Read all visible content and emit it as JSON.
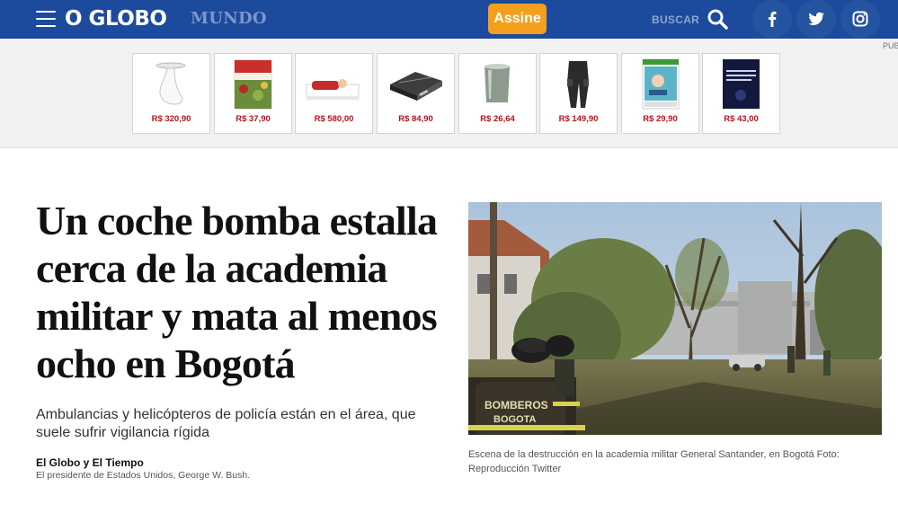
{
  "header": {
    "logo": "O GLOBO",
    "section": "MUNDO",
    "subscribe_label": "Assine",
    "search_label": "BUSCAR",
    "social": [
      "facebook-icon",
      "twitter-icon",
      "instagram-icon"
    ],
    "colors": {
      "bar": "#1c4a9c",
      "subscribe": "#f5a01d"
    }
  },
  "ads": {
    "tag": "PUBLICIDADE",
    "items": [
      {
        "icon": "glass-side-table",
        "price": "R$ 320,90"
      },
      {
        "icon": "cookbook",
        "price": "R$ 37,90"
      },
      {
        "icon": "baby-doll-bed",
        "price": "R$ 580,00"
      },
      {
        "icon": "electric-grill",
        "price": "R$ 84,90"
      },
      {
        "icon": "glass-candle-holder",
        "price": "R$ 26,64"
      },
      {
        "icon": "cargo-pants",
        "price": "R$ 149,90"
      },
      {
        "icon": "video-game-case",
        "price": "R$ 29,90"
      },
      {
        "icon": "book-cover",
        "price": "R$ 43,00"
      }
    ]
  },
  "article": {
    "headline": "Un coche bomba estalla cerca de la academia militar y mata al menos ocho en Bogotá",
    "subtitle": "Ambulancias y helicópteros de policía están en el área, que suele sufrir vigilancia rígida",
    "byline": "El Globo y El Tiempo",
    "byline_note": "El presidente de Estados Unidos, George W. Bush.",
    "photo": {
      "jacket_text_line1": "BOMBEROS",
      "jacket_text_line2": "BOGOTA",
      "caption": "Escena de la destrucción en la academia militar General Santander, en Bogotá Foto: Reproducción Twitter"
    }
  }
}
